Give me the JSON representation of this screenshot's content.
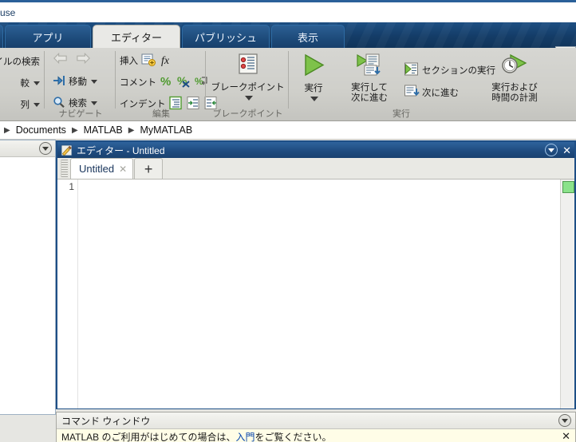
{
  "window": {
    "caption_fragment": "use"
  },
  "ribbon_tabs": [
    {
      "label": "",
      "active": false
    },
    {
      "label": "アプリ",
      "active": false
    },
    {
      "label": "エディター",
      "active": true
    },
    {
      "label": "パブリッシュ",
      "active": false
    },
    {
      "label": "表示",
      "active": false
    }
  ],
  "quick_access": [
    {
      "name": "new-script-icon",
      "glyph": "⬀"
    },
    {
      "name": "save-icon",
      "glyph": "💾"
    },
    {
      "name": "cut-icon",
      "glyph": "✂"
    },
    {
      "name": "copy-icon",
      "glyph": "⧉"
    },
    {
      "name": "paste-icon",
      "glyph": "📋"
    },
    {
      "name": "undo-icon",
      "glyph": "↩"
    },
    {
      "name": "redo-icon",
      "glyph": "↪"
    },
    {
      "name": "switch-window-icon",
      "glyph": "🗗"
    },
    {
      "name": "help-icon",
      "glyph": "?"
    }
  ],
  "ribbon_groups": [
    {
      "name": "file",
      "title": "",
      "items": [
        {
          "label": "イルの検索",
          "caret": false
        },
        {
          "label": "較",
          "caret": true
        },
        {
          "label": "列",
          "caret": true
        }
      ]
    },
    {
      "name": "navigate",
      "title": "ナビゲート",
      "items": [
        {
          "label": "",
          "caret": false
        },
        {
          "label": "移動",
          "caret": true
        },
        {
          "label": "検索",
          "caret": true
        }
      ]
    },
    {
      "name": "edit",
      "title": "編集",
      "items": [
        {
          "label": "挿入",
          "caret": false
        },
        {
          "label": "コメント",
          "caret": false
        },
        {
          "label": "インデント",
          "caret": false
        }
      ]
    },
    {
      "name": "breakpoints",
      "title": "ブレークポイント",
      "items": [
        {
          "label": "ブレークポイント",
          "caret": true
        }
      ]
    },
    {
      "name": "run",
      "title": "実行",
      "items": [
        {
          "label": "実行",
          "caret": true
        },
        {
          "label": "実行して\n次に進む",
          "caret": false
        },
        {
          "label": "セクションの実行",
          "caret": false
        },
        {
          "label": "次に進む",
          "caret": false
        },
        {
          "label": "実行および\n時間の計測",
          "caret": false
        }
      ]
    }
  ],
  "run_labels": {
    "run": "実行",
    "run_advance_l1": "実行して",
    "run_advance_l2": "次に進む",
    "run_section": "セクションの実行",
    "advance": "次に進む",
    "run_time_l1": "実行および",
    "run_time_l2": "時間の計測"
  },
  "breadcrumb": {
    "items": [
      "Documents",
      "MATLAB",
      "MyMATLAB"
    ],
    "separator": "▶"
  },
  "editor_panel": {
    "title": "エディター - Untitled",
    "icon": "editor-icon",
    "tabs": [
      {
        "label": "Untitled",
        "close": "✕"
      }
    ],
    "new_tab_label": "+",
    "gutter_lines": [
      "1"
    ],
    "code": ""
  },
  "command_window": {
    "title": "コマンド ウィンドウ",
    "message_prefix": "MATLAB のご利用がはじめての場合は、",
    "message_link": "入門",
    "message_suffix": "をご覧ください。",
    "close_label": "✕"
  },
  "colors": {
    "ribbon_blue": "#16426e",
    "panel_title_blue": "#1f4c80",
    "active_tab_bg": "#e9e9e6",
    "ribbon_bg": "#cfcfca",
    "cmd_bg": "#fffde7",
    "link": "#0645ad",
    "marker_green": "#8ae28a"
  }
}
